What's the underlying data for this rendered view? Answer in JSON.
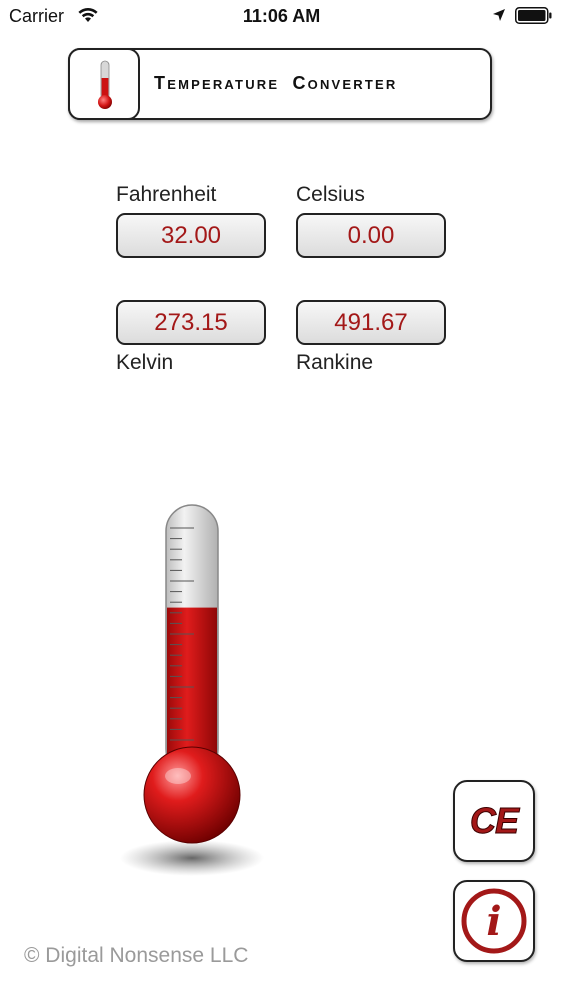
{
  "status_bar": {
    "carrier": "Carrier",
    "time": "11:06 AM"
  },
  "header": {
    "title": "Temperature Converter"
  },
  "fields": {
    "fahrenheit": {
      "label": "Fahrenheit",
      "value": "32.00"
    },
    "celsius": {
      "label": "Celsius",
      "value": "0.00"
    },
    "kelvin": {
      "label": "Kelvin",
      "value": "273.15"
    },
    "rankine": {
      "label": "Rankine",
      "value": "491.67"
    }
  },
  "thermometer": {
    "fill_fraction": 0.62
  },
  "buttons": {
    "clear_label": "CE",
    "info_label": "i"
  },
  "footer": {
    "copyright": "© Digital Nonsense LLC"
  },
  "colors": {
    "accent": "#a31818",
    "border": "#222222",
    "footer_text": "#9a9a9a"
  }
}
